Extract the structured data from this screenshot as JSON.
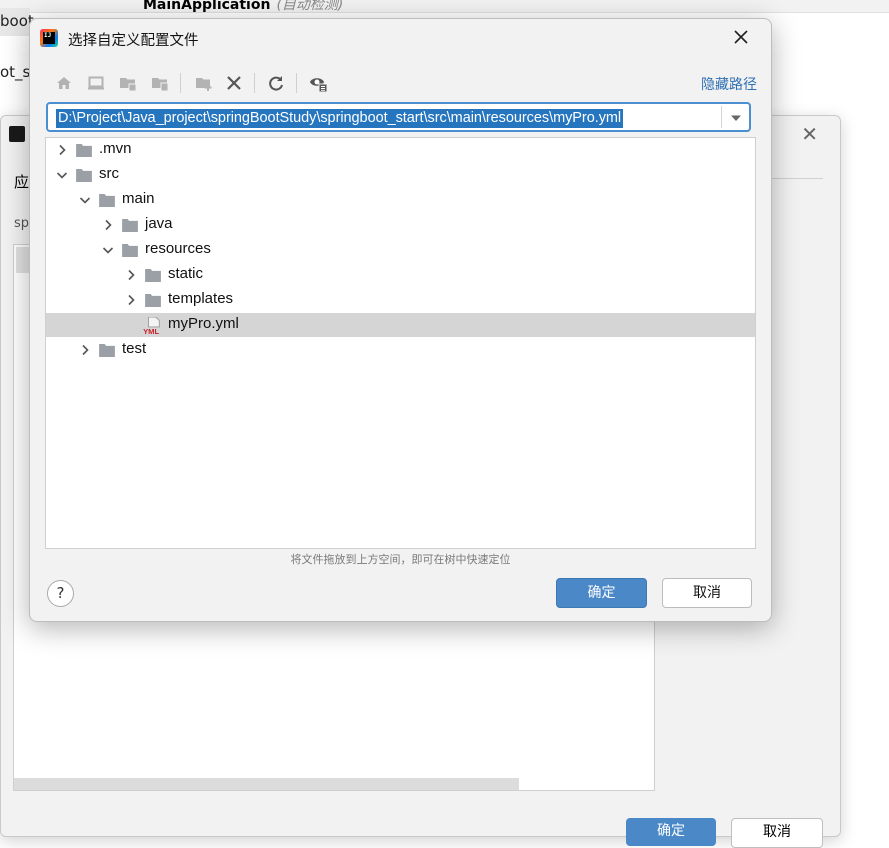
{
  "background": {
    "run_config_name": "MainApplication",
    "run_config_hint": "(自动检测)",
    "left_tab_1": "boot_",
    "left_tab_2": "ot_s",
    "bg_dialog_label_1": "应",
    "bg_dialog_label_2": "sp",
    "bg_ok_label": "确定",
    "bg_cancel_label": "取消"
  },
  "dialog": {
    "title": "选择自定义配置文件",
    "hide_path_label": "隐藏路径",
    "path_value": "D:\\Project\\Java_project\\springBootStudy\\springboot_start\\src\\main\\resources\\myPro.yml",
    "drag_hint": "将文件拖放到上方空间，即可在树中快速定位",
    "help_label": "?",
    "ok_label": "确定",
    "cancel_label": "取消"
  },
  "toolbar": {
    "icons": [
      "home-icon",
      "desktop-icon",
      "project-folder-icon",
      "module-folder-icon",
      "new-folder-icon",
      "delete-icon",
      "refresh-icon",
      "show-hidden-icon"
    ]
  },
  "tree": {
    "rows": [
      {
        "label": ".mvn",
        "depth": 0,
        "type": "folder",
        "expanded": false
      },
      {
        "label": "src",
        "depth": 0,
        "type": "folder",
        "expanded": true
      },
      {
        "label": "main",
        "depth": 1,
        "type": "folder",
        "expanded": true
      },
      {
        "label": "java",
        "depth": 2,
        "type": "folder",
        "expanded": false
      },
      {
        "label": "resources",
        "depth": 2,
        "type": "folder",
        "expanded": true
      },
      {
        "label": "static",
        "depth": 3,
        "type": "folder",
        "expanded": false
      },
      {
        "label": "templates",
        "depth": 3,
        "type": "folder",
        "expanded": false
      },
      {
        "label": "myPro.yml",
        "depth": 3,
        "type": "yml-file",
        "selected": true,
        "icon_text": "YML"
      },
      {
        "label": "test",
        "depth": 1,
        "type": "folder",
        "expanded": false
      }
    ]
  },
  "colors": {
    "accent": "#4a88c7",
    "selection": "#2675bf",
    "link": "#2f6fb3",
    "row_selected": "#d5d5d5",
    "folder": "#9aa0a6"
  }
}
